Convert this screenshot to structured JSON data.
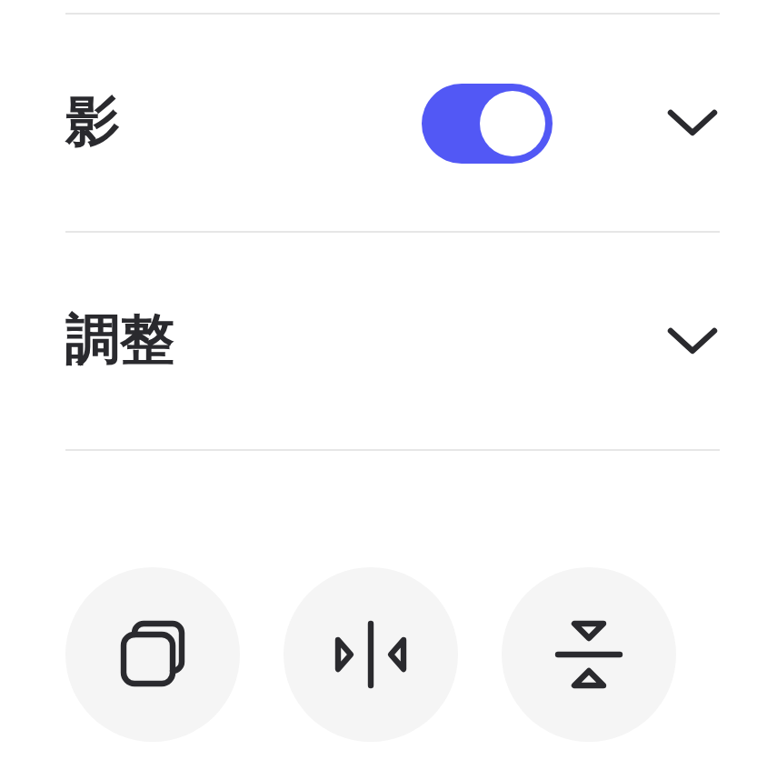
{
  "sections": [
    {
      "title": "影",
      "kind": "toggle",
      "on": true,
      "expanded": false
    },
    {
      "title": "調整",
      "kind": "plain",
      "expanded": false
    }
  ]
}
